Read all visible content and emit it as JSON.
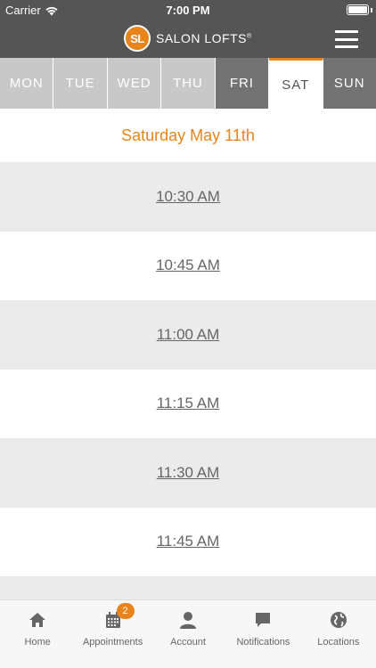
{
  "status_bar": {
    "carrier": "Carrier",
    "time": "7:00 PM"
  },
  "header": {
    "logo_text": "SL",
    "brand_name": "SALON LOFTS",
    "brand_mark": "®"
  },
  "days": [
    {
      "label": "MON",
      "state": "past"
    },
    {
      "label": "TUE",
      "state": "past"
    },
    {
      "label": "WED",
      "state": "past"
    },
    {
      "label": "THU",
      "state": "past"
    },
    {
      "label": "FRI",
      "state": "future"
    },
    {
      "label": "SAT",
      "state": "active"
    },
    {
      "label": "SUN",
      "state": "future"
    }
  ],
  "date_heading": "Saturday May 11th",
  "slots": [
    "10:30 AM",
    "10:45 AM",
    "11:00 AM",
    "11:15 AM",
    "11:30 AM",
    "11:45 AM",
    ""
  ],
  "tabbar": {
    "items": [
      {
        "label": "Home",
        "icon": "home-icon"
      },
      {
        "label": "Appointments",
        "icon": "calendar-icon",
        "badge": "2"
      },
      {
        "label": "Account",
        "icon": "person-icon"
      },
      {
        "label": "Notifications",
        "icon": "chat-bubble-icon"
      },
      {
        "label": "Locations",
        "icon": "globe-icon"
      }
    ]
  },
  "colors": {
    "header": "#555555",
    "accent": "#e8841a",
    "day_past": "#c8c8c8",
    "day_future": "#737373",
    "slot_alt": "#ebebeb"
  }
}
